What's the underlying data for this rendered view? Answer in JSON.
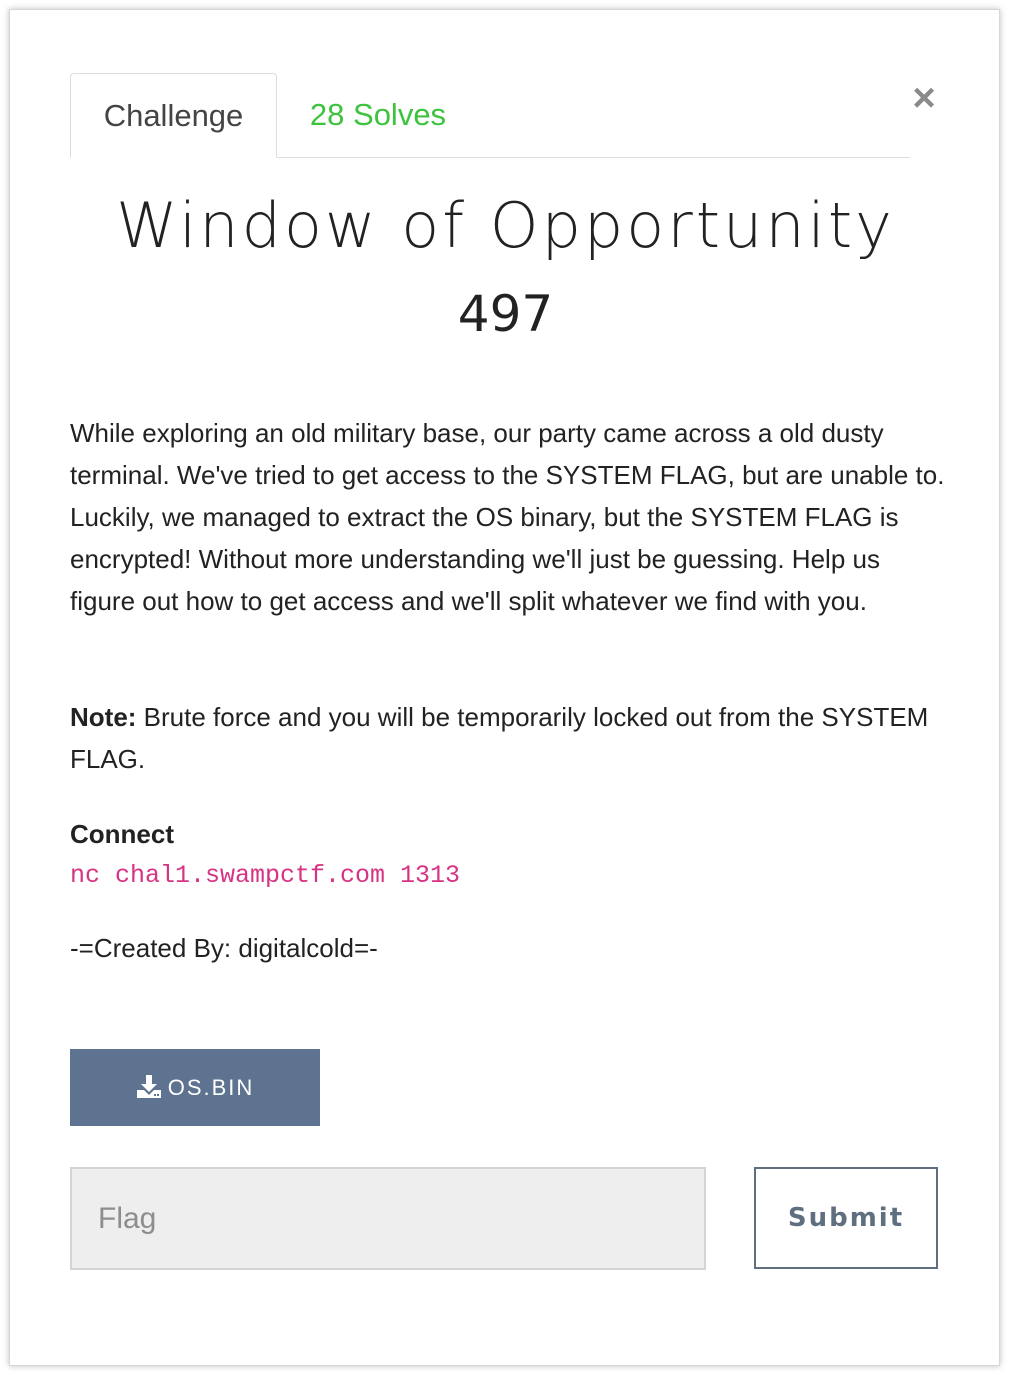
{
  "tabs": {
    "challenge": "Challenge",
    "solves": "28 Solves"
  },
  "close_label": "×",
  "challenge": {
    "name": "Window of Opportunity",
    "points": "497",
    "description": "While exploring an old military base, our party came across a old dusty terminal. We've tried to get access to the SYSTEM FLAG, but are unable to. Luckily, we managed to extract the OS binary, but the SYSTEM FLAG is encrypted! Without more understanding we'll just be guessing. Help us figure out how to get access and we'll split whatever we find with you.",
    "note_label": "Note:",
    "note_text": " Brute force and you will be temporarily locked out from the SYSTEM FLAG.",
    "connect_label": "Connect",
    "connect_command": "nc chal1.swampctf.com 1313",
    "author": "-=Created By: digitalcold=-"
  },
  "download": {
    "label": "OS.BIN",
    "icon": "download-icon"
  },
  "flag_form": {
    "placeholder": "Flag",
    "value": "",
    "submit_label": "Submit"
  },
  "colors": {
    "solves_green": "#3ec33e",
    "download_bg": "#5d7390",
    "connect_pink": "#d63384"
  }
}
